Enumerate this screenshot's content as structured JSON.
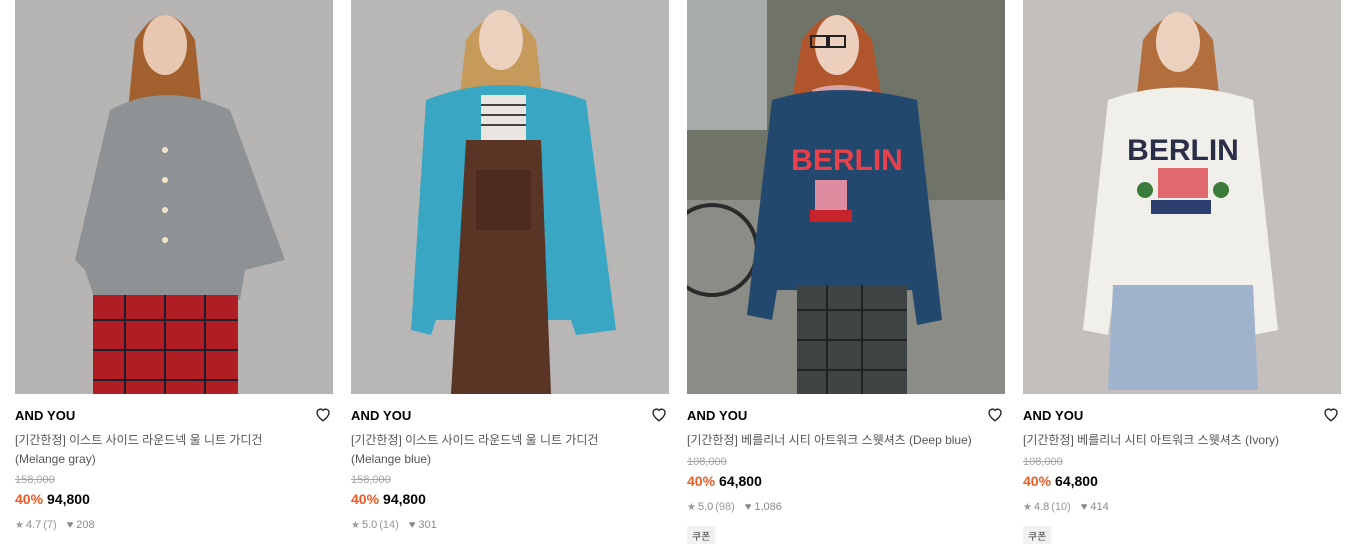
{
  "products": [
    {
      "brand": "AND YOU",
      "name_line1": "[기간한정] 이스트 사이드 라운드넥 울 니트 가디건",
      "name_line2": "(Melange gray)",
      "original_price": "158,000",
      "discount": "40%",
      "price": "94,800",
      "rating": "4.7",
      "reviews": "(7)",
      "likes": "208",
      "coupon": "",
      "image": {
        "bg": "#b7b5b4",
        "top": "#8f9294",
        "bottom": "#b01e24",
        "hair": "#a2612e"
      }
    },
    {
      "brand": "AND YOU",
      "name_line1": "[기간한정] 이스트 사이드 라운드넥 울 니트 가디건",
      "name_line2": "(Melange blue)",
      "original_price": "158,000",
      "discount": "40%",
      "price": "94,800",
      "rating": "5.0",
      "reviews": "(14)",
      "likes": "301",
      "coupon": "",
      "image": {
        "bg": "#b9b7b6",
        "top": "#39a6c4",
        "bottom": "#5a3424",
        "hair": "#c69a5b"
      }
    },
    {
      "brand": "AND YOU",
      "name_line1": "[기간한정] 베를리너 시티 아트워크 스웻셔츠 (Deep blue)",
      "name_line2": "",
      "original_price": "108,000",
      "discount": "40%",
      "price": "64,800",
      "rating": "5.0",
      "reviews": "(98)",
      "likes": "1,086",
      "coupon": "쿠폰",
      "image": {
        "bg": "#707468",
        "top": "#23486e",
        "bottom": "#3f4545",
        "hair": "#b1552c",
        "print": "BERLIN"
      }
    },
    {
      "brand": "AND YOU",
      "name_line1": "[기간한정] 베를리너 시티 아트워크 스웻셔츠 (Ivory)",
      "name_line2": "",
      "original_price": "108,000",
      "discount": "40%",
      "price": "64,800",
      "rating": "4.8",
      "reviews": "(10)",
      "likes": "414",
      "coupon": "쿠폰",
      "image": {
        "bg": "#c2bfbd",
        "top": "#f1efea",
        "bottom": "#9fb3cc",
        "hair": "#b26f3d",
        "print": "BERLIN"
      }
    }
  ]
}
